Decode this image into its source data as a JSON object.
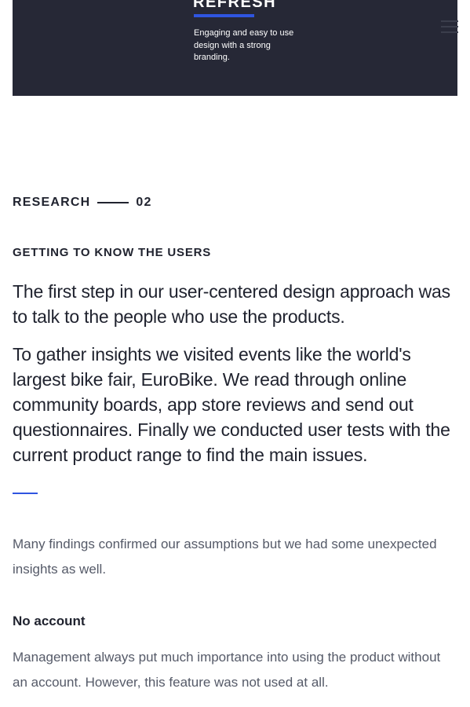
{
  "hero": {
    "title": "REFRESH",
    "tagline": "Engaging and easy to use design with a strong branding.",
    "background_color": "#262836",
    "accent_color": "#2f55e0"
  },
  "nav": {
    "menu_icon": "hamburger-menu-icon"
  },
  "section": {
    "label": "RESEARCH",
    "number": "02",
    "subheading": "GETTING TO KNOW THE USERS",
    "lead_paragraphs": [
      "The first step in our user-centered design approach was to talk to the people who use the products.",
      "To gather insights we visited events like the world's largest bike fair, EuroBike. We read through online community boards, app store reviews and send out questionnaires. Finally we conducted user tests with the current product range to find the main issues."
    ],
    "intro": "Many findings confirmed our assumptions but we had some unexpected insights as well.",
    "findings": [
      {
        "title": "No account",
        "text": "Management always put much importance into using the product without an account. However, this feature was not used at all."
      }
    ]
  }
}
